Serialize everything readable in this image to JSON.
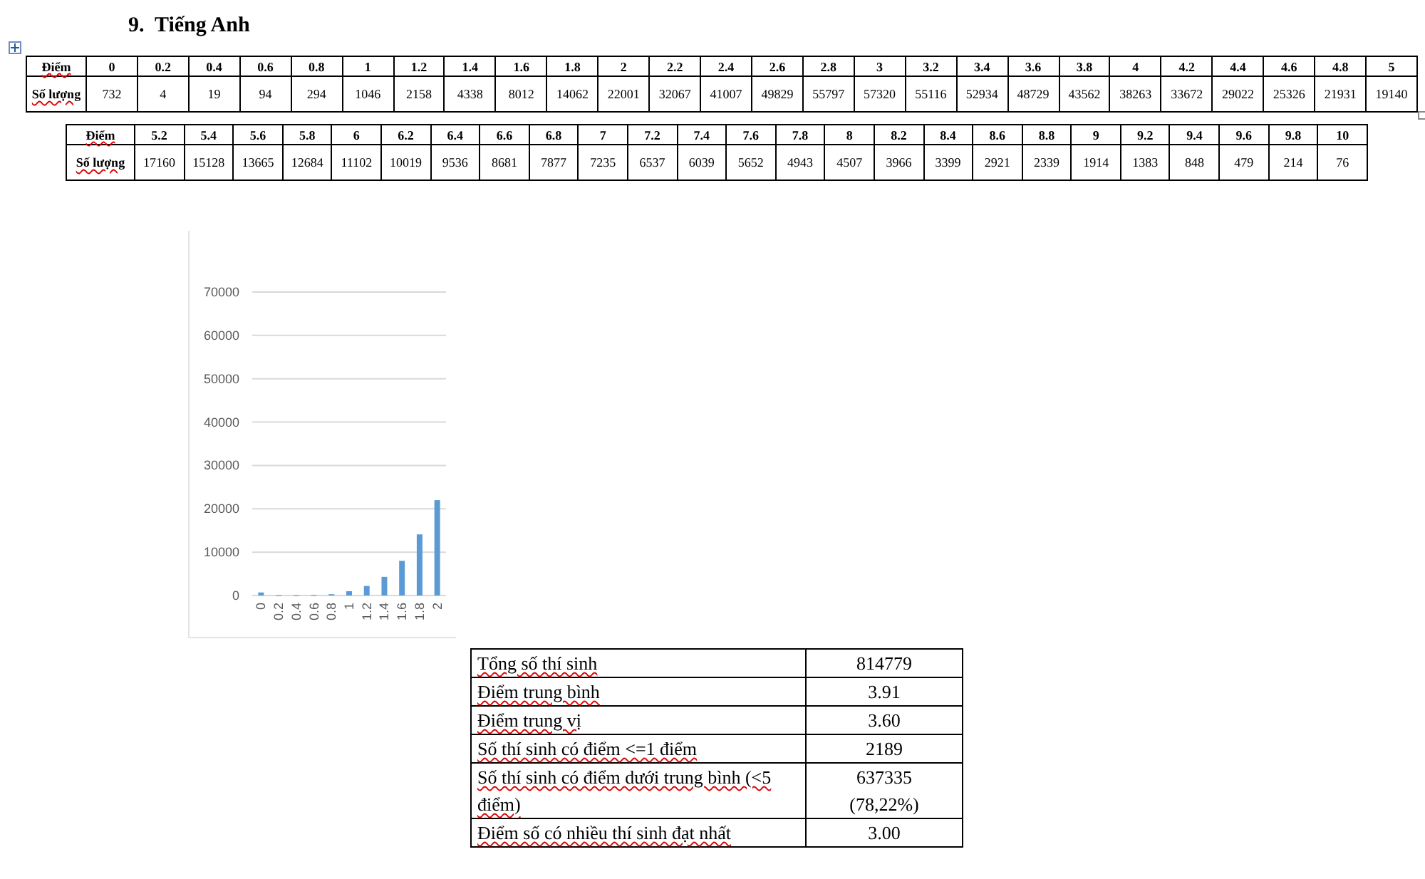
{
  "heading": "9.  Tiếng Anh",
  "score_tables": [
    {
      "header_label": "Điểm",
      "count_label": "Số lượng",
      "scores": [
        "0",
        "0.2",
        "0.4",
        "0.6",
        "0.8",
        "1",
        "1.2",
        "1.4",
        "1.6",
        "1.8",
        "2",
        "2.2",
        "2.4",
        "2.6",
        "2.8",
        "3",
        "3.2",
        "3.4",
        "3.6",
        "3.8",
        "4",
        "4.2",
        "4.4",
        "4.6",
        "4.8",
        "5"
      ],
      "counts": [
        "732",
        "4",
        "19",
        "94",
        "294",
        "1046",
        "2158",
        "4338",
        "8012",
        "14062",
        "22001",
        "32067",
        "41007",
        "49829",
        "55797",
        "57320",
        "55116",
        "52934",
        "48729",
        "43562",
        "38263",
        "33672",
        "29022",
        "25326",
        "21931",
        "19140"
      ]
    },
    {
      "header_label": "Điểm",
      "count_label": "Số lượng",
      "scores": [
        "5.2",
        "5.4",
        "5.6",
        "5.8",
        "6",
        "6.2",
        "6.4",
        "6.6",
        "6.8",
        "7",
        "7.2",
        "7.4",
        "7.6",
        "7.8",
        "8",
        "8.2",
        "8.4",
        "8.6",
        "8.8",
        "9",
        "9.2",
        "9.4",
        "9.6",
        "9.8",
        "10"
      ],
      "counts": [
        "17160",
        "15128",
        "13665",
        "12684",
        "11102",
        "10019",
        "9536",
        "8681",
        "7877",
        "7235",
        "6537",
        "6039",
        "5652",
        "4943",
        "4507",
        "3966",
        "3399",
        "2921",
        "2339",
        "1914",
        "1383",
        "848",
        "479",
        "214",
        "76"
      ]
    }
  ],
  "chart": {
    "chart_data": {
      "type": "bar",
      "categories": [
        "0",
        "0.2",
        "0.4",
        "0.6",
        "0.8",
        "1",
        "1.2",
        "1.4",
        "1.6",
        "1.8",
        "2"
      ],
      "series": [
        {
          "color": "#5b9bd5",
          "values": [
            700,
            0,
            0,
            100,
            300,
            1000,
            2200,
            4300,
            8000,
            14100,
            22000
          ]
        }
      ],
      "grid": true,
      "ylim": [
        0,
        70000
      ],
      "yticks": [
        0,
        10000,
        20000,
        30000,
        40000,
        50000,
        60000,
        70000
      ]
    }
  },
  "stats": [
    {
      "label": "Tổng số thí sinh",
      "value": "814779"
    },
    {
      "label": "Điểm trung bình",
      "value": "3.91"
    },
    {
      "label": "Điểm trung vị",
      "value": "3.60"
    },
    {
      "label": "Số thí sinh có điểm <=1 điểm",
      "value": "2189"
    },
    {
      "label": "Số thí sinh có điểm dưới trung bình (<5 điểm)",
      "value": "637335\n(78,22%)"
    },
    {
      "label": "Điểm số có nhiều thí sinh đạt nhất",
      "value": "3.00"
    }
  ]
}
